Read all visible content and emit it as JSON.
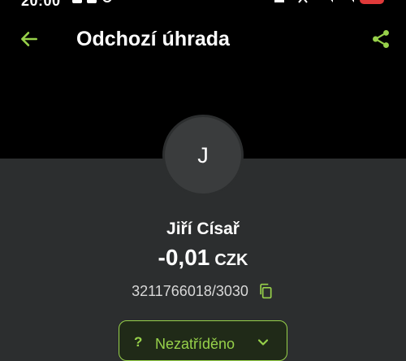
{
  "status_bar": {
    "time": "20:00"
  },
  "header": {
    "title": "Odchozí úhrada"
  },
  "contact": {
    "initial": "J",
    "name": "Jiří Císař"
  },
  "transaction": {
    "amount": "-0,01",
    "currency": "CZK",
    "account": "3211766018/3030"
  },
  "category": {
    "icon_text": "?",
    "label": "Nezatříděno"
  },
  "colors": {
    "accent": "#97d14a",
    "background_top": "#000000",
    "background_bottom": "#2c2e2f"
  },
  "icons": {
    "back": "arrow-left-icon",
    "share": "share-icon",
    "copy": "copy-icon",
    "dropdown": "chevron-down-icon"
  }
}
